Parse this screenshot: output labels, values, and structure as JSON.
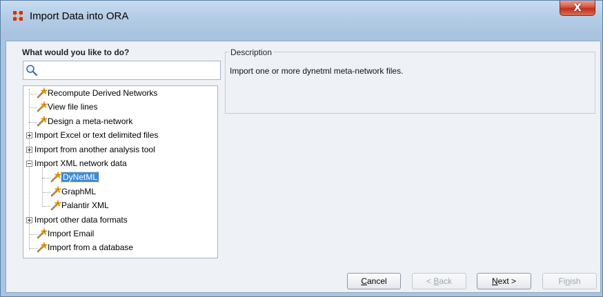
{
  "window": {
    "title": "Import Data into ORA",
    "close_glyph": "X"
  },
  "left_panel": {
    "label": "What would you like to do?",
    "search_placeholder": "",
    "tree": [
      {
        "label": "Recompute Derived Networks",
        "icon": "wand-icon"
      },
      {
        "label": "View file lines",
        "icon": "wand-icon"
      },
      {
        "label": "Design a meta-network",
        "icon": "wand-icon"
      },
      {
        "label": "Import Excel or text delimited files",
        "expander": "plus"
      },
      {
        "label": "Import from another analysis tool",
        "expander": "plus"
      },
      {
        "label": "Import XML network data",
        "expander": "minus"
      },
      {
        "label": "DyNetML",
        "icon": "wand-icon",
        "selected": true
      },
      {
        "label": "GraphML",
        "icon": "wand-icon"
      },
      {
        "label": "Palantir XML",
        "icon": "wand-icon"
      },
      {
        "label": "Import other data formats",
        "expander": "plus"
      },
      {
        "label": "Import Email",
        "icon": "wand-icon"
      },
      {
        "label": "Import from a database",
        "icon": "wand-icon"
      }
    ]
  },
  "description": {
    "legend": "Description",
    "text": "Import one or more dynetml meta-network files."
  },
  "buttons": {
    "cancel": {
      "pre": "",
      "mn": "C",
      "post": "ancel"
    },
    "back": {
      "pre": "< ",
      "mn": "B",
      "post": "ack"
    },
    "next": {
      "pre": "",
      "mn": "N",
      "post": "ext >"
    },
    "finish": {
      "pre": "Fi",
      "mn": "n",
      "post": "ish"
    }
  },
  "colors": {
    "selection": "#3d8bd9",
    "titlebar": "#b5cde6",
    "close": "#c2301a"
  }
}
